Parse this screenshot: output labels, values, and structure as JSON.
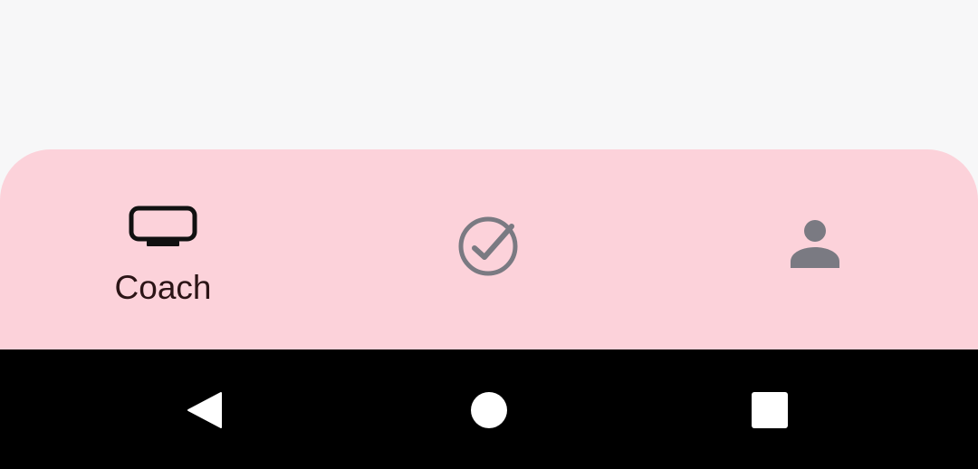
{
  "bottom_nav": {
    "items": [
      {
        "label": "Coach",
        "icon": "tv-icon",
        "selected": true
      },
      {
        "label": "",
        "icon": "check-circle-icon",
        "selected": false
      },
      {
        "label": "",
        "icon": "person-icon",
        "selected": false
      }
    ]
  },
  "system_nav": {
    "buttons": [
      "back-icon",
      "home-icon",
      "recents-icon"
    ]
  },
  "colors": {
    "background": "#f7f7f8",
    "nav_background": "#fcd2da",
    "selected_icon": "#111111",
    "unselected_icon": "#7a7a82",
    "label_text": "#2b1416",
    "system_bar": "#000000"
  }
}
